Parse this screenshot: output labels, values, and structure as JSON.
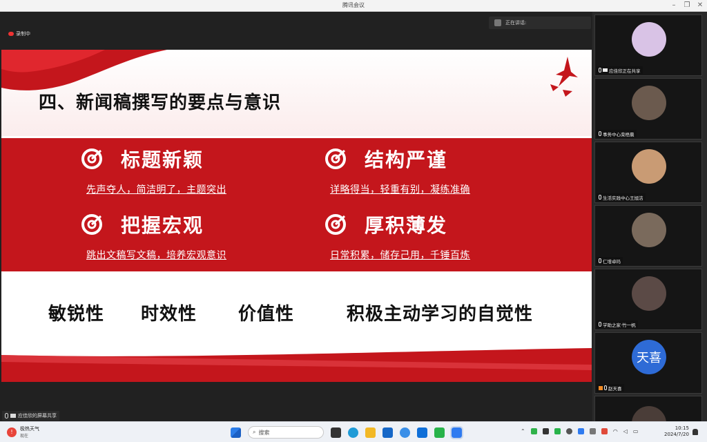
{
  "window": {
    "title": "腾讯会议"
  },
  "recording": {
    "label": "录制中"
  },
  "speaking": {
    "label": "正在讲话:"
  },
  "slide": {
    "heading": "四、新闻稿撰写的要点与意识",
    "cards": [
      {
        "title": "标题新颖",
        "subtitle": "先声夺人，简洁明了，主题突出"
      },
      {
        "title": "结构严谨",
        "subtitle": "详略得当，轻重有别，凝练准确"
      },
      {
        "title": "把握宏观",
        "subtitle": "跳出文稿写文稿，培养宏观意识"
      },
      {
        "title": "厚积薄发",
        "subtitle": "日常积累，储存己用，千锤百炼"
      }
    ],
    "qualities": [
      "敏锐性",
      "时效性",
      "价值性",
      "积极主动学习的自觉性"
    ]
  },
  "share_label": "应佳欣的屏幕共享",
  "participants": [
    {
      "name": "应佳欣正在共享",
      "color": "#d9c3e6"
    },
    {
      "name": "事务中心栾梧晨",
      "color": "#6b5a4e"
    },
    {
      "name": "生活实践中心王旭洁",
      "color": "#c99b74"
    },
    {
      "name": "仁增卓玛",
      "color": "#7a6a5c"
    },
    {
      "name": "学助之家·竹一帆",
      "color": "#5b4a46"
    },
    {
      "name": "赵天喜",
      "initials": "天喜",
      "color": "#2e6bd6"
    }
  ],
  "taskbar": {
    "weather_title": "极热天气",
    "weather_sub": "现在",
    "weather_badge": "!",
    "search_placeholder": "搜索",
    "time": "10:15",
    "date": "2024/7/20"
  }
}
